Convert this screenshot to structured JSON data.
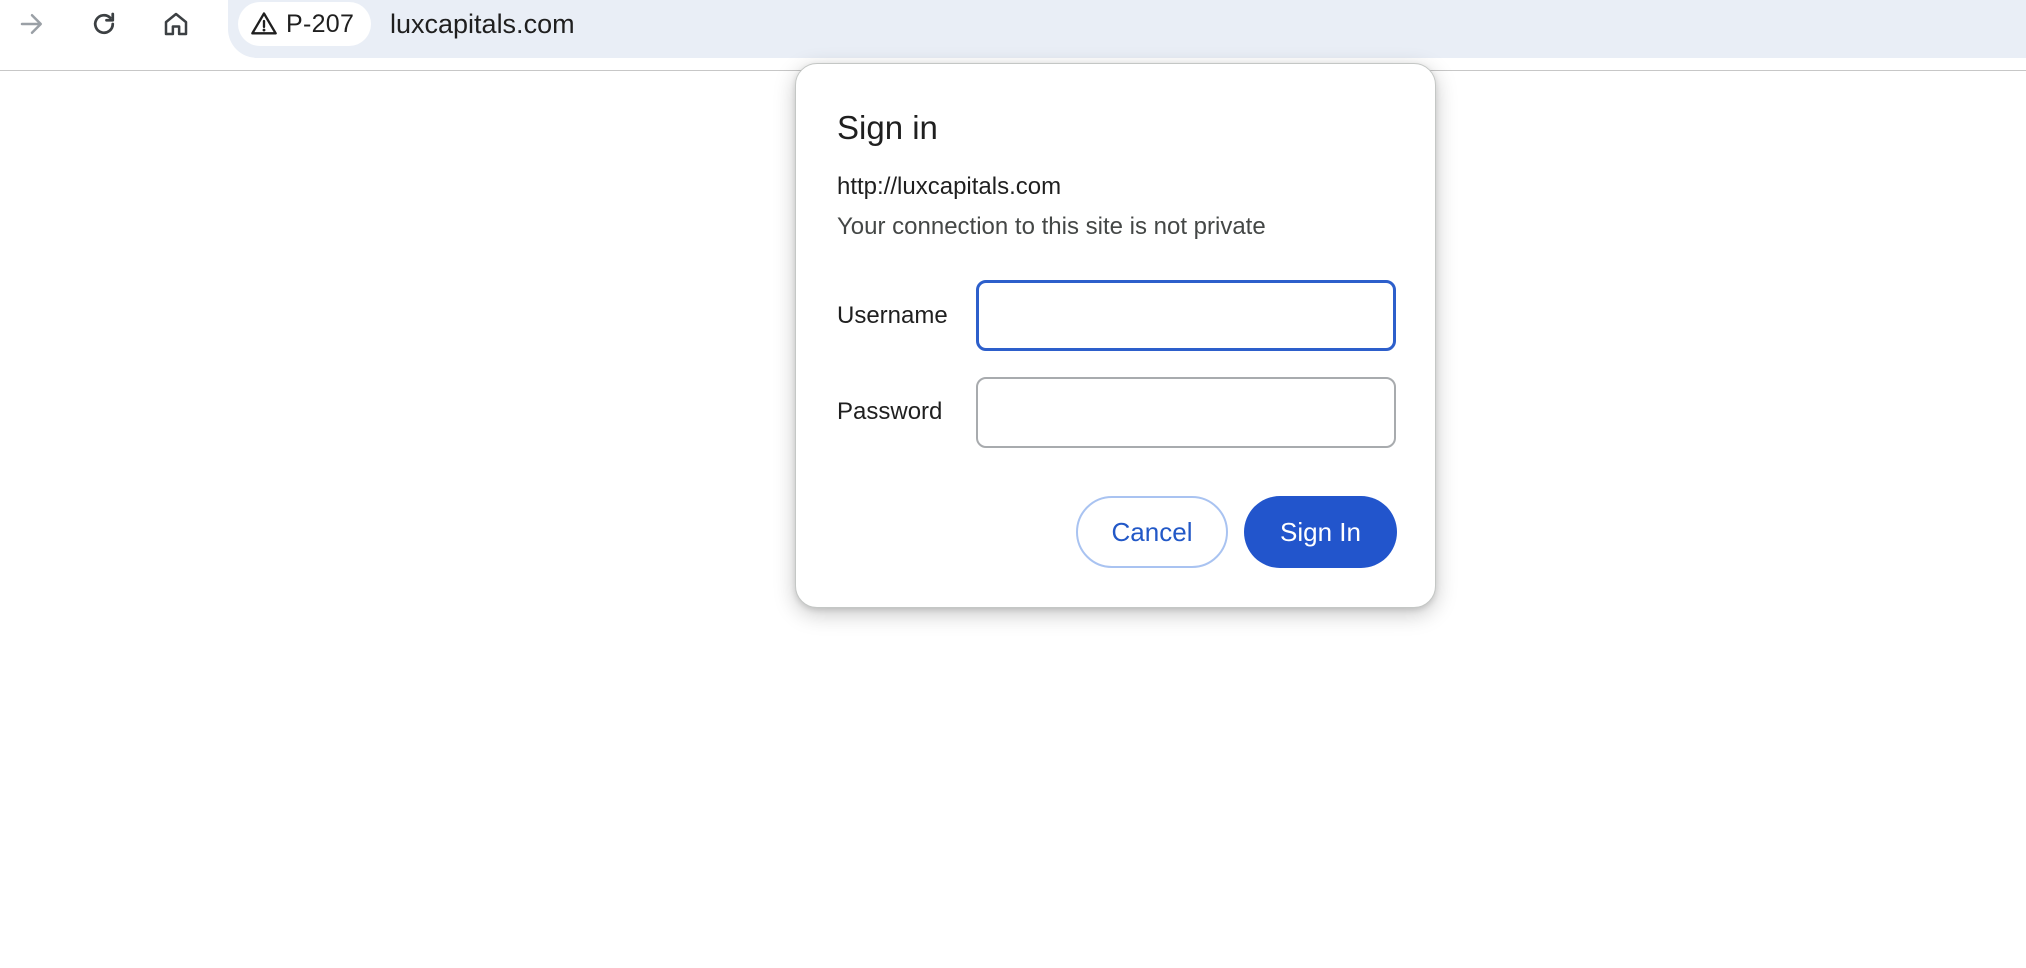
{
  "browser": {
    "security_chip": {
      "icon": "warning-triangle-icon",
      "label": "P-207"
    },
    "url": "luxcapitals.com",
    "nav_icons": [
      "forward-arrow-icon",
      "reload-icon",
      "home-icon"
    ]
  },
  "dialog": {
    "title": "Sign in",
    "origin": "http://luxcapitals.com",
    "warning": "Your connection to this site is not private",
    "username_label": "Username",
    "username_value": "",
    "password_label": "Password",
    "password_value": "",
    "cancel_label": "Cancel",
    "signin_label": "Sign In"
  },
  "colors": {
    "accent": "#2255cc",
    "focus_ring": "#2d5fcb",
    "omnibox_bg": "#e9eef6"
  }
}
